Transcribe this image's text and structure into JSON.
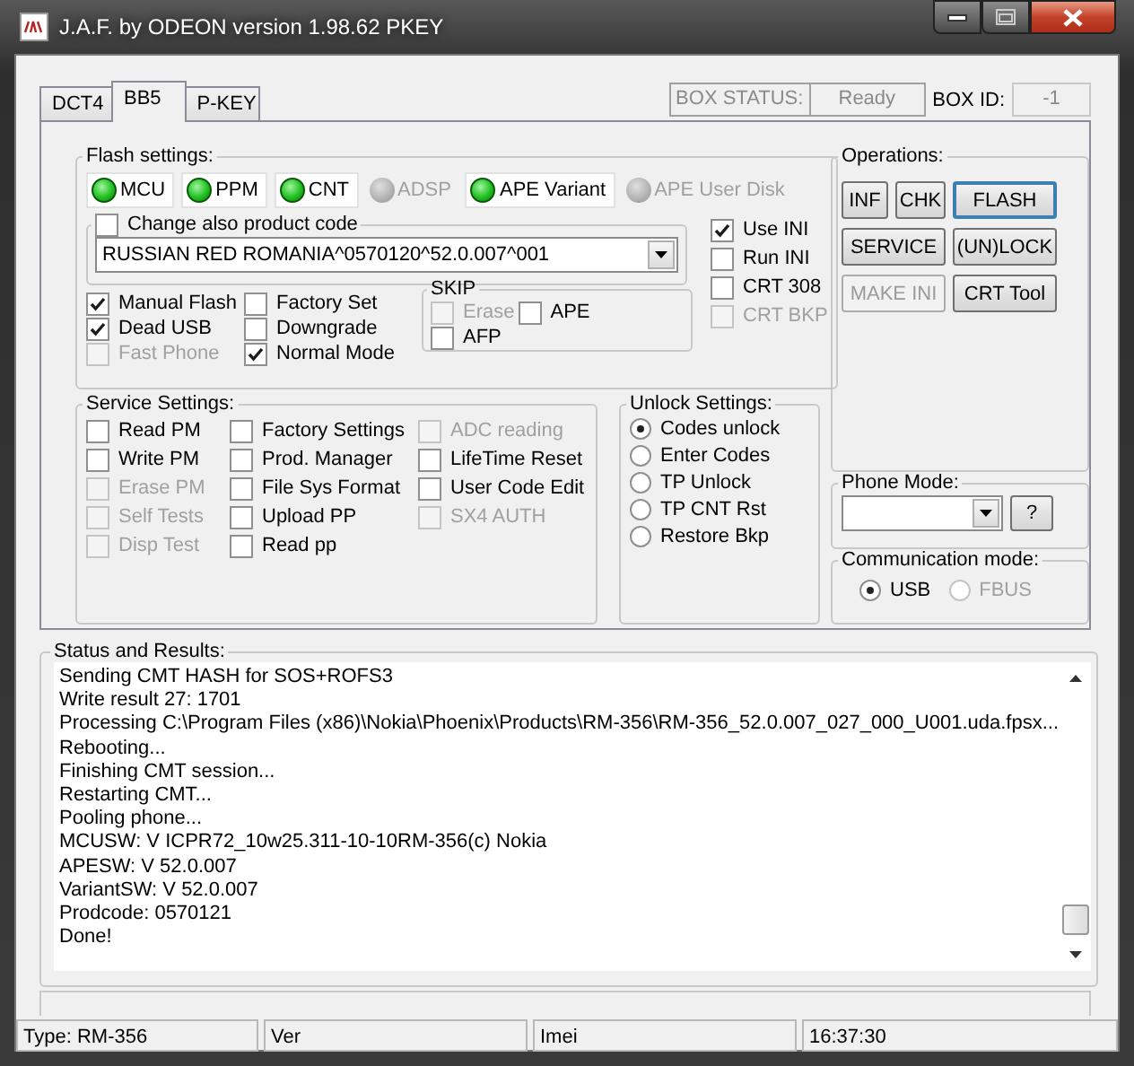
{
  "window": {
    "title": "J.A.F. by ODEON version 1.98.62 PKEY"
  },
  "tabs": [
    {
      "label": "DCT4",
      "selected": false
    },
    {
      "label": "BB5",
      "selected": true
    },
    {
      "label": "P-KEY",
      "selected": false
    }
  ],
  "box_status": {
    "label": "BOX STATUS:",
    "value": "Ready",
    "id_label": "BOX ID:",
    "id_value": "-1"
  },
  "flash_settings": {
    "title": "Flash settings:",
    "indicators": [
      {
        "label": "MCU",
        "on": true
      },
      {
        "label": "PPM",
        "on": true
      },
      {
        "label": "CNT",
        "on": true
      },
      {
        "label": "ADSP",
        "on": false
      },
      {
        "label": "APE Variant",
        "on": true
      },
      {
        "label": "APE User Disk",
        "on": false
      }
    ],
    "product_code": {
      "label": "Change also product code",
      "checked": false,
      "value": "RUSSIAN RED ROMANIA^0570120^52.0.007^001"
    },
    "ini_options": [
      {
        "label": "Use INI",
        "checked": true,
        "disabled": false
      },
      {
        "label": "Run INI",
        "checked": false,
        "disabled": false
      },
      {
        "label": "CRT 308",
        "checked": false,
        "disabled": false
      },
      {
        "label": "CRT BKP",
        "checked": false,
        "disabled": true
      }
    ],
    "options": [
      [
        {
          "label": "Manual Flash",
          "checked": true,
          "disabled": false
        },
        {
          "label": "Dead USB",
          "checked": true,
          "disabled": false
        },
        {
          "label": "Fast Phone",
          "checked": false,
          "disabled": true
        }
      ],
      [
        {
          "label": "Factory Set",
          "checked": false,
          "disabled": false
        },
        {
          "label": "Downgrade",
          "checked": false,
          "disabled": false
        },
        {
          "label": "Normal Mode",
          "checked": true,
          "disabled": false
        }
      ]
    ],
    "skip": {
      "title": "SKIP",
      "rows": [
        [
          {
            "label": "Erase",
            "checked": false,
            "disabled": true
          },
          {
            "label": "APE",
            "checked": false,
            "disabled": false
          }
        ],
        [
          {
            "label": "AFP",
            "checked": false,
            "disabled": false
          }
        ]
      ]
    }
  },
  "service_settings": {
    "title": "Service Settings:",
    "columns": [
      [
        {
          "label": "Read PM",
          "checked": false,
          "disabled": false
        },
        {
          "label": "Write PM",
          "checked": false,
          "disabled": false
        },
        {
          "label": "Erase PM",
          "checked": false,
          "disabled": true
        },
        {
          "label": "Self Tests",
          "checked": false,
          "disabled": true
        },
        {
          "label": "Disp Test",
          "checked": false,
          "disabled": true
        }
      ],
      [
        {
          "label": "Factory Settings",
          "checked": false,
          "disabled": false
        },
        {
          "label": "Prod. Manager",
          "checked": false,
          "disabled": false
        },
        {
          "label": "File Sys Format",
          "checked": false,
          "disabled": false
        },
        {
          "label": "Upload PP",
          "checked": false,
          "disabled": false
        },
        {
          "label": "Read pp",
          "checked": false,
          "disabled": false
        }
      ],
      [
        {
          "label": "ADC reading",
          "checked": false,
          "disabled": true
        },
        {
          "label": "LifeTime Reset",
          "checked": false,
          "disabled": false
        },
        {
          "label": "User Code Edit",
          "checked": false,
          "disabled": false
        },
        {
          "label": "SX4 AUTH",
          "checked": false,
          "disabled": true
        }
      ]
    ]
  },
  "unlock_settings": {
    "title": "Unlock Settings:",
    "options": [
      {
        "label": "Codes unlock",
        "selected": true
      },
      {
        "label": "Enter Codes",
        "selected": false
      },
      {
        "label": "TP Unlock",
        "selected": false
      },
      {
        "label": "TP CNT Rst",
        "selected": false
      },
      {
        "label": "Restore Bkp",
        "selected": false
      }
    ]
  },
  "operations": {
    "title": "Operations:",
    "buttons": [
      {
        "label": "INF",
        "disabled": false,
        "default": false
      },
      {
        "label": "CHK",
        "disabled": false,
        "default": false
      },
      {
        "label": "FLASH",
        "disabled": false,
        "default": true
      },
      {
        "label": "SERVICE",
        "disabled": false,
        "default": false
      },
      {
        "label": "(UN)LOCK",
        "disabled": false,
        "default": false
      },
      {
        "label": "MAKE INI",
        "disabled": true,
        "default": false
      },
      {
        "label": "CRT Tool",
        "disabled": false,
        "default": false
      }
    ]
  },
  "phone_mode": {
    "title": "Phone Mode:",
    "help": "?"
  },
  "communication_mode": {
    "title": "Communication mode:",
    "options": [
      {
        "label": "USB",
        "selected": true,
        "disabled": false
      },
      {
        "label": "FBUS",
        "selected": false,
        "disabled": true
      }
    ]
  },
  "status_results": {
    "title": "Status and Results:",
    "lines": [
      "Sending CMT HASH for SOS+ROFS3",
      "Write result 27: 1701",
      "Processing C:\\Program Files (x86)\\Nokia\\Phoenix\\Products\\RM-356\\RM-356_52.0.007_027_000_U001.uda.fpsx...",
      "Rebooting...",
      "Finishing CMT session...",
      "Restarting CMT...",
      "Pooling phone...",
      "MCUSW: V ICPR72_10w25.311-10-10RM-356(c) Nokia",
      "APESW: V 52.0.007",
      "VariantSW: V 52.0.007",
      "Prodcode: 0570121",
      "Done!"
    ]
  },
  "status_bar": [
    "Type: RM-356",
    "Ver",
    "Imei",
    "16:37:30"
  ]
}
